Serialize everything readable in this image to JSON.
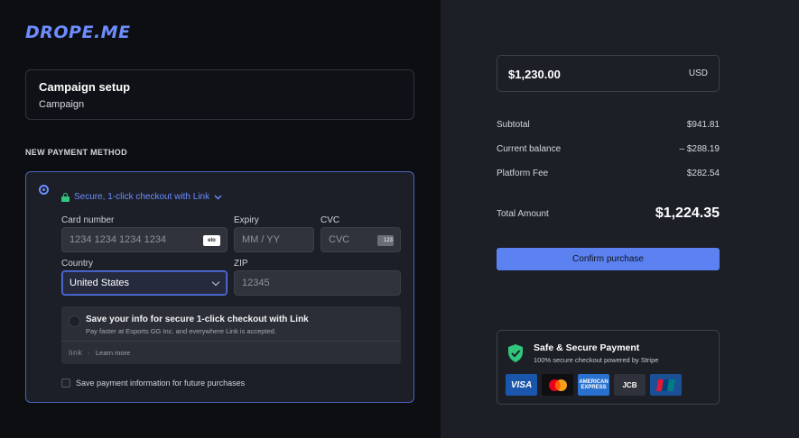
{
  "brand": {
    "logo_text": "DROPE.ME"
  },
  "campaign": {
    "title": "Campaign setup",
    "subtitle": "Campaign"
  },
  "payment": {
    "section_label": "NEW PAYMENT METHOD",
    "link_checkout_label": "Secure, 1-click checkout with Link",
    "card_number": {
      "label": "Card number",
      "placeholder": "1234 1234 1234 1234",
      "badge": "elo"
    },
    "expiry": {
      "label": "Expiry",
      "placeholder": "MM / YY"
    },
    "cvc": {
      "label": "CVC",
      "placeholder": "CVC",
      "badge": "123"
    },
    "country": {
      "label": "Country",
      "value": "United States"
    },
    "zip": {
      "label": "ZIP",
      "placeholder": "12345"
    },
    "link_save": {
      "title": "Save your info for secure 1-click checkout with Link",
      "description": "Pay faster at Esports GG Inc. and everywhere Link is accepted.",
      "logo": "link",
      "separator": "·",
      "learn_more": "Learn more"
    },
    "save_future_label": "Save payment information for future purchases"
  },
  "order": {
    "amount": "$1,230.00",
    "currency": "USD",
    "rows": [
      {
        "label": "Subtotal",
        "value": "$941.81"
      },
      {
        "label": "Current balance",
        "value": "– $288.19"
      },
      {
        "label": "Platform Fee",
        "value": "$282.54"
      }
    ],
    "total_label": "Total Amount",
    "total_value": "$1,224.35",
    "confirm_label": "Confirm purchase"
  },
  "security": {
    "title": "Safe & Secure Payment",
    "subtitle": "100% secure checkout powered by Stripe",
    "cards": [
      "VISA",
      "mastercard",
      "AMERICAN EXPRESS",
      "JCB",
      "UnionPay"
    ]
  },
  "colors": {
    "accent": "#5b82f0",
    "link": "#6d8dff",
    "secure_green": "#30c67c"
  }
}
